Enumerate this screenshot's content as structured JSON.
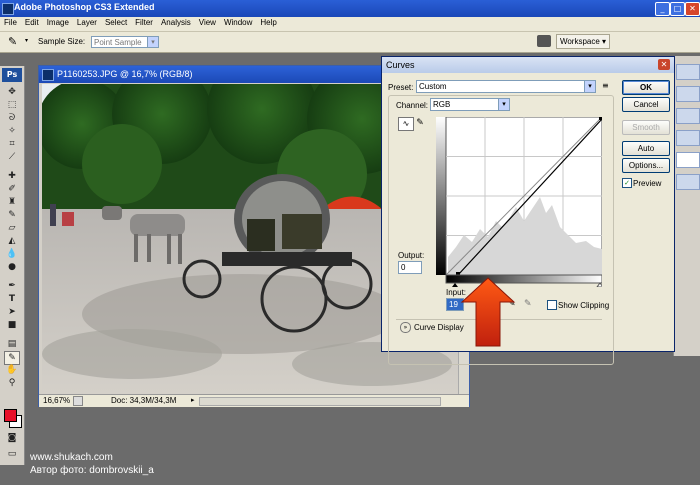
{
  "app": {
    "title": "Adobe Photoshop CS3 Extended",
    "window_controls": {
      "minimize": "_",
      "maximize": "□",
      "close": "✕"
    }
  },
  "menubar": [
    "File",
    "Edit",
    "Image",
    "Layer",
    "Select",
    "Filter",
    "Analysis",
    "View",
    "Window",
    "Help"
  ],
  "options_bar": {
    "sample_size_label": "Sample Size:",
    "sample_size_value": "Point Sample",
    "workspace_label": "Workspace ▾"
  },
  "tools": {
    "logo": "Ps",
    "icons": [
      "move-icon",
      "marquee-icon",
      "lasso-icon",
      "quick-select-icon",
      "crop-icon",
      "slice-icon",
      "healing-icon",
      "brush-icon",
      "stamp-icon",
      "history-brush-icon",
      "eraser-icon",
      "gradient-icon",
      "blur-icon",
      "dodge-icon",
      "pen-icon",
      "type-icon",
      "path-select-icon",
      "shape-icon",
      "notes-icon",
      "eyedropper-icon",
      "hand-icon",
      "zoom-icon"
    ],
    "foreground_color": "#e8102a",
    "background_color": "#ffffff"
  },
  "document": {
    "title": "P1160253.JPG @ 16,7% (RGB/8)",
    "zoom": "16,67%",
    "doc_size": "Doc: 34,3M/34,3M"
  },
  "curves": {
    "title": "Curves",
    "preset_label": "Preset:",
    "preset_value": "Custom",
    "channel_label": "Channel:",
    "channel_value": "RGB",
    "output_label": "Output:",
    "output_value": "0",
    "input_label": "Input:",
    "input_value": "19",
    "show_clipping_label": "Show Clipping",
    "curve_display_label": "Curve Display Options",
    "buttons": {
      "ok": "OK",
      "cancel": "Cancel",
      "smooth": "Smooth",
      "auto": "Auto",
      "options": "Options..."
    },
    "preview_label": "Preview",
    "preview_checked": true,
    "close": "✕"
  },
  "watermark": {
    "line1": "www.shukach.com",
    "line2": "Автор фото: dombrovskii_a"
  },
  "colors": {
    "title_blue": "#1a47b8",
    "arrow_red": "#e23a12",
    "dialog_bg": "#ece9d8"
  }
}
